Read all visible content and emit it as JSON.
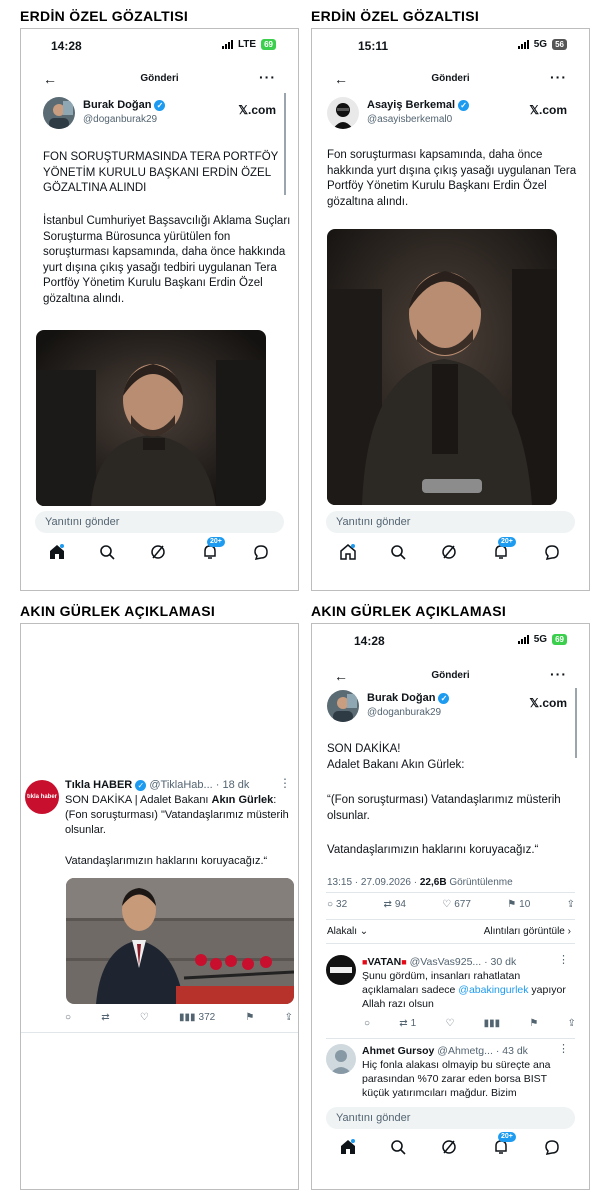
{
  "sections": {
    "top_left_title": "ERDİN ÖZEL GÖZALTISI",
    "top_right_title": "ERDİN ÖZEL GÖZALTISI",
    "bottom_left_title": "AKIN GÜRLEK AÇIKLAMASI",
    "bottom_right_title": "AKIN GÜRLEK AÇIKLAMASI"
  },
  "p1": {
    "time": "14:28",
    "network": "LTE",
    "battery": "69",
    "header": "Gönderi",
    "name": "Burak Doğan",
    "handle": "@doganburak29",
    "source": "𝕏.com",
    "headline": "FON SORUŞTURMASINDA TERA PORTFÖY YÖNETİM KURULU BAŞKANI ERDİN ÖZEL GÖZALTINA ALINDI",
    "body": "İstanbul Cumhuriyet Başsavcılığı Aklama Suçları Soruşturma Bürosunca yürütülen fon soruşturması kapsamında, daha önce hakkında yurt dışına çıkış yasağı tedbiri uygulanan Tera Portföy Yönetim Kurulu Başkanı Erdin Özel gözaltına alındı.",
    "reply_placeholder": "Yanıtını gönder",
    "badge": "20+"
  },
  "p2": {
    "time": "15:11",
    "network": "5G",
    "battery": "56",
    "header": "Gönderi",
    "name": "Asayiş Berkemal",
    "handle": "@asayisberkemal0",
    "source": "𝕏.com",
    "body": "Fon soruşturması kapsamında, daha önce hakkında yurt dışına çıkış yasağı uygulanan Tera Portföy Yönetim Kurulu Başkanı Erdin Özel gözaltına alındı.",
    "reply_placeholder": "Yanıtını gönder",
    "badge": "20+"
  },
  "p3": {
    "name": "Tıkla HABER",
    "handle": "@TiklaHab...",
    "time_ago": "· 18 dk",
    "avatar_text": "tıkla haber",
    "line1_pre": "SON DAKİKA | Adalet Bakanı ",
    "line1_bold": "Akın Gürlek",
    "line1_post": ":",
    "line2": "(Fon soruşturması) \"Vatandaşlarımız müsterih olsunlar.",
    "line3": "Vatandaşlarımızın haklarını koruyacağız.“",
    "views": "372"
  },
  "p4": {
    "time": "14:28",
    "network": "5G",
    "battery": "69",
    "header": "Gönderi",
    "name": "Burak Doğan",
    "handle": "@doganburak29",
    "source": "𝕏.com",
    "l1": "SON DAKİKA!",
    "l2": "Adalet Bakanı Akın Gürlek:",
    "l3": "“(Fon soruşturması) Vatandaşlarımız müsterih olsunlar.",
    "l4": "Vatandaşlarımızın haklarını koruyacağız.“",
    "timestamp": "13:15 · 27.09.2026 · ",
    "view_count": "22,6B",
    "view_label": " Görüntülenme",
    "replies": "32",
    "reposts": "94",
    "likes": "677",
    "bookmarks": "10",
    "related": "Alakalı",
    "quotes": "Alıntıları görüntüle",
    "r1_name": "VATAN",
    "r1_handle": "@VasVas925...",
    "r1_time": "· 30 dk",
    "r1_pre": "Şunu gördüm, insanları rahatlatan açıklamaları sadece ",
    "r1_link": "@abakingurlek",
    "r1_post": " yapıyor Allah razı olsun",
    "r1_reposts": "1",
    "r2_name": "Ahmet Gursoy",
    "r2_handle": "@Ahmetg...",
    "r2_time": "· 43 dk",
    "r2_text": "Hiç fonla alakası olmayip bu süreçte ana parasından %70 zarar eden borsa BIST küçük yatırımcıları mağdur. Bizim",
    "reply_placeholder": "Yanıtını gönder",
    "badge": "20+"
  },
  "colors": {
    "accent": "#1d9bf0",
    "battery_green": "#3ccf4e",
    "text": "#0f1419",
    "muted": "#536471"
  }
}
